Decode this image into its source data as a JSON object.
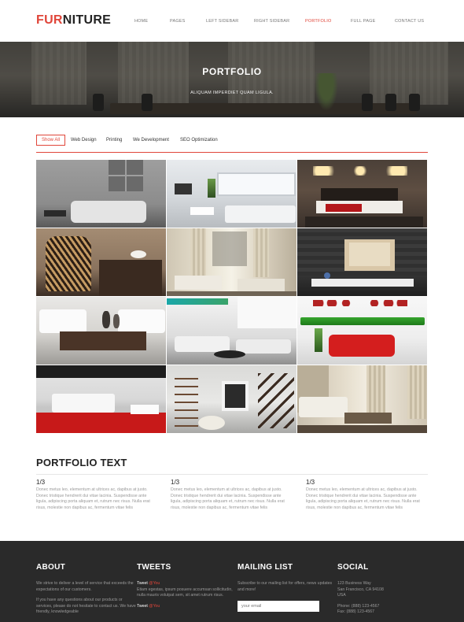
{
  "brand": {
    "part1": "FUR",
    "part2": "NITURE",
    "accent_color": "#e0463a"
  },
  "nav": [
    {
      "label": "HOME",
      "active": false
    },
    {
      "label": "PAGES",
      "active": false
    },
    {
      "label": "LEFT SIDEBAR",
      "active": false
    },
    {
      "label": "RIGHT SIDEBAR",
      "active": false
    },
    {
      "label": "PORTFOLIO",
      "active": true
    },
    {
      "label": "FULL PAGE",
      "active": false
    },
    {
      "label": "CONTACT US",
      "active": false
    }
  ],
  "hero": {
    "title": "PORTFOLIO",
    "subtitle": "ALIQUAM IMPERDIET QUAM LIGULA."
  },
  "filters": [
    {
      "label": "Show All",
      "active": true
    },
    {
      "label": "Web Design",
      "active": false
    },
    {
      "label": "Printing",
      "active": false
    },
    {
      "label": "We Development",
      "active": false
    },
    {
      "label": "SEO Optimization",
      "active": false
    }
  ],
  "gallery": [
    {
      "name": "grey-sofa-room-image"
    },
    {
      "name": "white-living-room-image"
    },
    {
      "name": "bedroom-red-bed-image"
    },
    {
      "name": "zebra-armchair-image"
    },
    {
      "name": "curtained-living-room-image"
    },
    {
      "name": "dark-wall-tv-unit-image"
    },
    {
      "name": "white-sofas-coffee-table-image"
    },
    {
      "name": "white-lounge-image"
    },
    {
      "name": "red-sofa-image"
    },
    {
      "name": "red-floor-room-image"
    },
    {
      "name": "white-room-staircase-image"
    },
    {
      "name": "bright-curtained-room-image"
    }
  ],
  "portfolio": {
    "title": "PORTFOLIO TEXT",
    "columns": [
      {
        "heading": "1/3",
        "text": "Donec metus leo, elementum at ultrices ac, dapibus at justo. Donec tristique hendrerit dui vitae lacinia. Suspendisse ante ligula, adipiscing porta aliquam et, rutrum nec risus. Nulla erat risus, molestie non dapibus ac, fermentum vitae felis"
      },
      {
        "heading": "1/3",
        "text": "Donec metus leo, elementum at ultrices ac, dapibus at justo. Donec tristique hendrerit dui vitae lacinia. Suspendisse ante ligula, adipiscing porta aliquam et, rutrum nec risus. Nulla erat risus, molestie non dapibus ac, fermentum vitae felis"
      },
      {
        "heading": "1/3",
        "text": "Donec metus leo, elementum at ultrices ac, dapibus at justo. Donec tristique hendrerit dui vitae lacinia. Suspendisse ante ligula, adipiscing porta aliquam et, rutrum nec risus. Nulla erat risus, molestie non dapibus ac, fermentum vitae felis"
      }
    ]
  },
  "footer": {
    "about": {
      "title": "ABOUT",
      "p1": "We strive to deliver a level of service that exceeds the expectations of our customers.",
      "p2": "If you have any questions about our products or services, please do not hesitate to contact us. We have friendly, knowledgeable"
    },
    "tweets": {
      "title": "TWEETS",
      "tweet1_label": "Tweet",
      "tweet1_handle": "@You",
      "tweet1_text": "Etiam egestas, ipsum posuere accumsan sollicitudin, nulla mauris volutpat sem, sit amet rutrum risus.",
      "tweet2_label": "Tweet",
      "tweet2_handle": "@You"
    },
    "mailing": {
      "title": "MAILING LIST",
      "text": "Subscribe to our mailing list for offers, news updates and more!",
      "placeholder": "your email"
    },
    "social": {
      "title": "SOCIAL",
      "address1": "123 Business Way",
      "address2": "San Francisco, CA 94108",
      "address3": "USA",
      "phone": "Phone: (888) 123-4567",
      "fax": "Fax: (888) 123-4567"
    }
  }
}
